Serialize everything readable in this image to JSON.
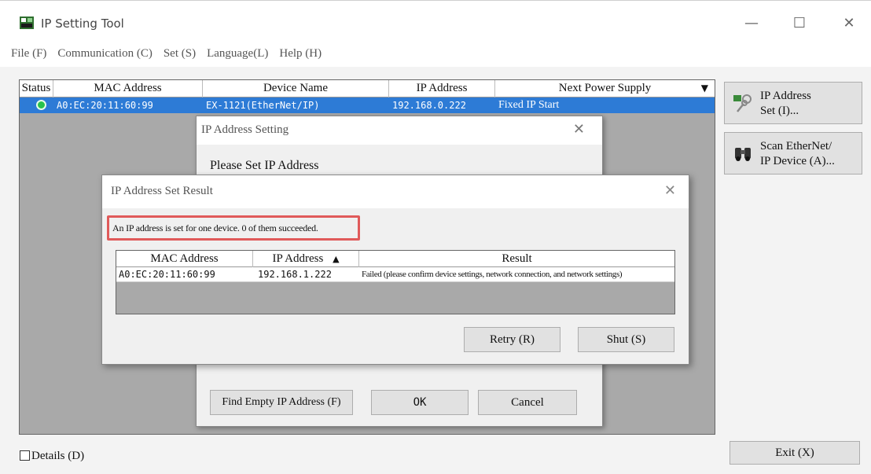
{
  "window": {
    "title": "IP Setting Tool",
    "minimize_glyph": "—",
    "maximize_glyph": "☐",
    "close_glyph": "✕"
  },
  "menu": [
    "File (F)",
    "Communication (C)",
    "Set (S)",
    "Language(L)",
    "Help (H)"
  ],
  "grid": {
    "headers": [
      "Status",
      "MAC Address",
      "Device Name",
      "IP Address",
      "Next Power Supply"
    ],
    "sort_glyph": "▼",
    "rows": [
      {
        "status": "ok",
        "mac": "A0:EC:20:11:60:99",
        "device_name": "EX-1121(EtherNet/IP)",
        "ip": "192.168.0.222",
        "next_power": "Fixed IP Start"
      }
    ]
  },
  "side": {
    "ip_set_line1": "IP Address",
    "ip_set_line2": "Set (I)...",
    "scan_line1": "Scan EtherNet/",
    "scan_line2": "IP Device (A)..."
  },
  "details_label": "Details (D)",
  "exit_label": "Exit (X)",
  "setting_dialog": {
    "title": "IP Address Setting",
    "prompt": "Please Set IP Address",
    "find_empty": "Find Empty IP Address (F)",
    "ok": "OK",
    "cancel": "Cancel"
  },
  "result_dialog": {
    "title": "IP Address Set Result",
    "message": "An IP address is set for one device. 0 of them succeeded.",
    "headers": [
      "MAC Address",
      "IP Address",
      "Result"
    ],
    "sort_glyph": "▲",
    "rows": [
      {
        "mac": "A0:EC:20:11:60:99",
        "ip": "192.168.1.222",
        "result": "Failed (please confirm device settings, network connection, and network settings)"
      }
    ],
    "retry": "Retry (R)",
    "shut": "Shut (S)"
  },
  "colors": {
    "selection": "#2d7bd6",
    "status_ok": "#27c24c",
    "highlight_border": "#e05a5a"
  }
}
